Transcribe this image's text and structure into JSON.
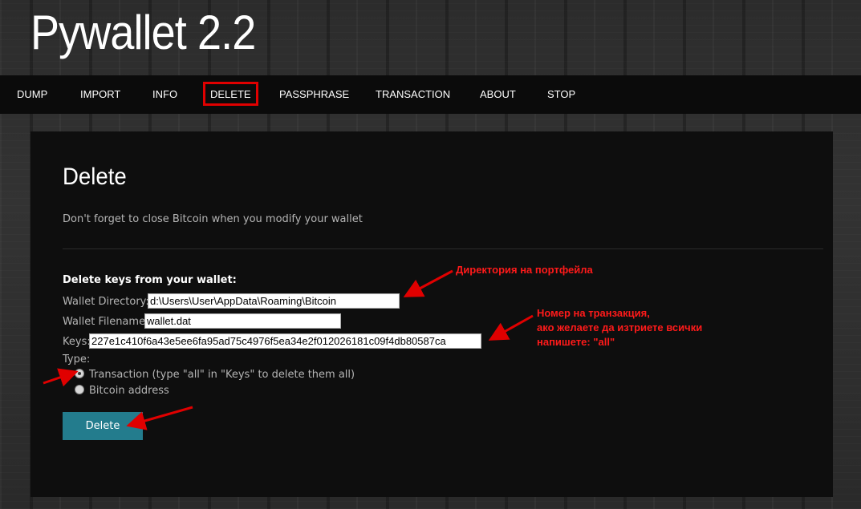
{
  "app": {
    "title": "Pywallet 2.2"
  },
  "nav": {
    "items": [
      {
        "label": "DUMP"
      },
      {
        "label": "IMPORT"
      },
      {
        "label": "INFO"
      },
      {
        "label": "DELETE"
      },
      {
        "label": "PASSPHRASE"
      },
      {
        "label": "TRANSACTION"
      },
      {
        "label": "ABOUT"
      },
      {
        "label": "STOP"
      }
    ],
    "active": "DELETE"
  },
  "page": {
    "title": "Delete",
    "warning": "Don't forget to close Bitcoin when you modify your wallet"
  },
  "form": {
    "section_title": "Delete keys from your wallet:",
    "wallet_directory": {
      "label": "Wallet Directory:",
      "value": "d:\\Users\\User\\AppData\\Roaming\\Bitcoin"
    },
    "wallet_filename": {
      "label": "Wallet Filename:",
      "value": "wallet.dat"
    },
    "keys": {
      "label": "Keys:",
      "value": "227e1c410f6a43e5ee6fa95ad75c4976f5ea34e2f012026181c09f4db80587ca"
    },
    "type": {
      "label": "Type:",
      "options": [
        {
          "label": "Transaction (type \"all\" in \"Keys\" to delete them all)",
          "checked": true
        },
        {
          "label": "Bitcoin address",
          "checked": false
        }
      ]
    },
    "submit_label": "Delete"
  },
  "annotations": {
    "directory_note": "Директория на портфейла",
    "keys_note_line1": "Номер на транзакция,",
    "keys_note_line2": "ако желаете да изтриете всички",
    "keys_note_line3": "напишете: \"all\"",
    "color": "#ff1a1a"
  },
  "theme": {
    "accent": "#237c8d",
    "highlight": "#e00000"
  }
}
